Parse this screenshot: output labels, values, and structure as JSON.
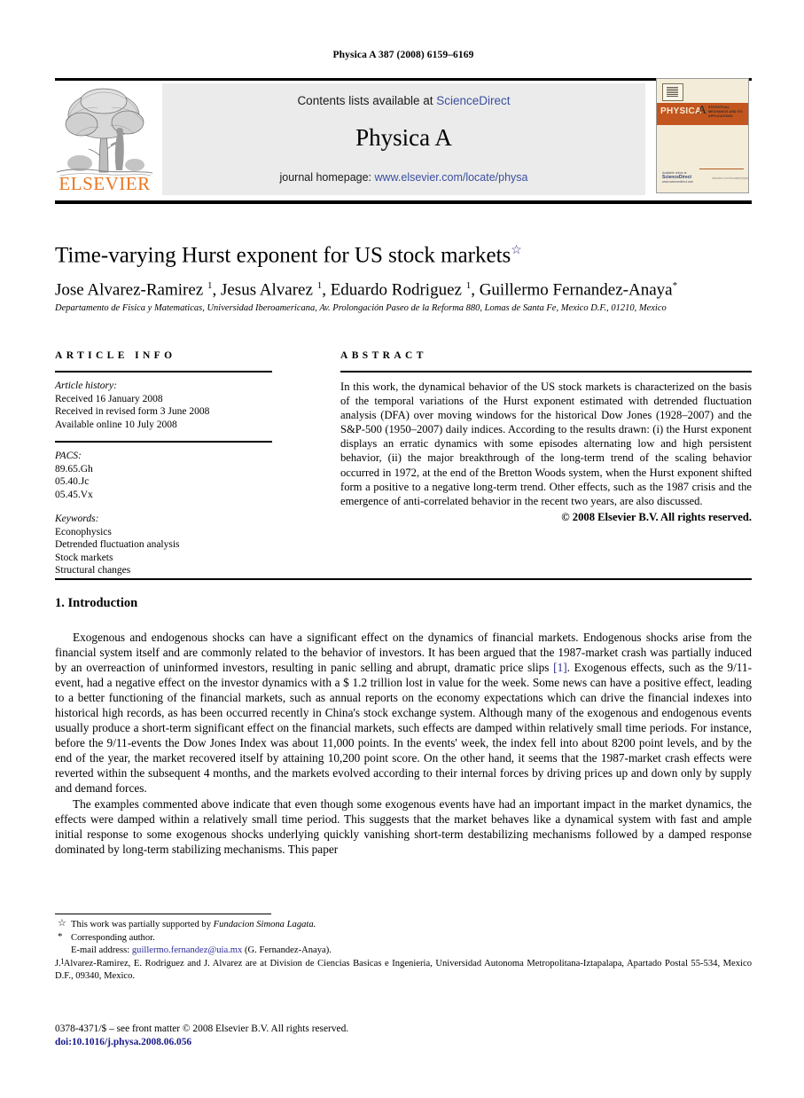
{
  "running_head": "Physica A 387 (2008) 6159–6169",
  "banner": {
    "publisher": "ELSEVIER",
    "contents_prefix": "Contents lists available at ",
    "contents_link": "ScienceDirect",
    "journal_title": "Physica A",
    "homepage_prefix": "journal homepage: ",
    "homepage_url": "www.elsevier.com/locate/physa",
    "cover": {
      "brand": "PHYSICA",
      "letter": "A",
      "subtitle": "STATISTICAL MECHANICS AND ITS APPLICATIONS",
      "sciencedirect": "ScienceDirect",
      "available_online": "Available online at",
      "sd_url": "www.sciencedirect.com",
      "elsevier": "elsevier.com/locate/physa"
    }
  },
  "article": {
    "title": "Time-varying Hurst exponent for US stock markets",
    "title_star": "☆",
    "authors_html": "Jose Alvarez-Ramirez <sup>1</sup>, Jesus Alvarez <sup>1</sup>, Eduardo Rodriguez <sup>1</sup>, Guillermo Fernandez-Anaya<sup>*</sup>",
    "affiliation": "Departamento de Fisica y Matematicas, Universidad Iberoamericana, Av. Prolongación Paseo de la Reforma 880, Lomas de Santa Fe, Mexico D.F., 01210, Mexico"
  },
  "info": {
    "heading": "ARTICLE INFO",
    "history_label": "Article history:",
    "history": [
      "Received 16 January 2008",
      "Received in revised form 3 June 2008",
      "Available online 10 July 2008"
    ],
    "pacs_label": "PACS:",
    "pacs": [
      "89.65.Gh",
      "05.40.Jc",
      "05.45.Vx"
    ],
    "keywords_label": "Keywords:",
    "keywords": [
      "Econophysics",
      "Detrended fluctuation analysis",
      "Stock markets",
      "Structural changes"
    ]
  },
  "abstract": {
    "heading": "ABSTRACT",
    "text": "In this work, the dynamical behavior of the US stock markets is characterized on the basis of the temporal variations of the Hurst exponent estimated with detrended fluctuation analysis (DFA) over moving windows for the historical Dow Jones (1928–2007) and the S&P-500 (1950–2007) daily indices. According to the results drawn: (i) the Hurst exponent displays an erratic dynamics with some episodes alternating low and high persistent behavior, (ii) the major breakthrough of the long-term trend of the scaling behavior occurred in 1972, at the end of the Bretton Woods system, when the Hurst exponent shifted form a positive to a negative long-term trend. Other effects, such as the 1987 crisis and the emergence of anti-correlated behavior in the recent two years, are also discussed.",
    "copyright": "© 2008 Elsevier B.V. All rights reserved."
  },
  "body": {
    "section_heading": "1. Introduction",
    "paragraph1_a": "Exogenous and endogenous shocks can have a significant effect on the dynamics of financial markets. Endogenous shocks arise from the financial system itself and are commonly related to the behavior of investors. It has been argued that the 1987-market crash was partially induced by an overreaction of uninformed investors, resulting in panic selling and abrupt, dramatic price slips ",
    "paragraph1_ref": "[1]",
    "paragraph1_b": ". Exogenous effects, such as the 9/11-event, had a negative effect on the investor dynamics with a $ 1.2 trillion lost in value for the week. Some news can have a positive effect, leading to a better functioning of the financial markets, such as annual reports on the economy expectations which can drive the financial indexes into historical high records, as has been occurred recently in China's stock exchange system. Although many of the exogenous and endogenous events usually produce a short-term significant effect on the financial markets, such effects are damped within relatively small time periods. For instance, before the 9/11-events the Dow Jones Index was about 11,000 points. In the events' week, the index fell into about 8200 point levels, and by the end of the year, the market recovered itself by attaining 10,200 point score. On the other hand, it seems that the 1987-market crash effects were reverted within the subsequent 4 months, and the markets evolved according to their internal forces by driving prices up and down only by supply and demand forces.",
    "paragraph2": "The examples commented above indicate that even though some exogenous events have had an important impact in the market dynamics, the effects were damped within a relatively small time period. This suggests that the market behaves like a dynamical system with fast and ample initial response to some exogenous shocks underlying quickly vanishing short-term destabilizing mechanisms followed by a damped response dominated by long-term stabilizing mechanisms. This paper"
  },
  "footnotes": {
    "funding_mark": "☆",
    "funding_prefix": "This work was partially supported by ",
    "funding_italic": "Fundacion Simona Lagata.",
    "corresponding_mark": "*",
    "corresponding": "Corresponding author.",
    "email_label": "E-mail address:",
    "email": "guillermo.fernandez@uia.mx",
    "email_suffix": " (G. Fernandez-Anaya).",
    "note1_mark": "1",
    "note1": "J. Alvarez-Ramirez, E. Rodriguez and J. Alvarez are at Division de Ciencias Basicas e Ingenieria, Universidad Autonoma Metropolitana-Iztapalapa, Apartado Postal 55-534, Mexico D.F., 09340, Mexico."
  },
  "footer": {
    "issn_line": "0378-4371/$ – see front matter © 2008 Elsevier B.V. All rights reserved.",
    "doi": "doi:10.1016/j.physa.2008.06.056"
  }
}
